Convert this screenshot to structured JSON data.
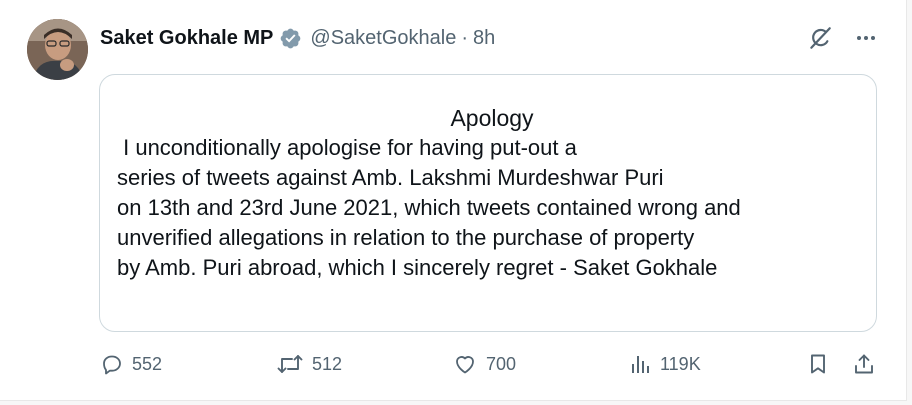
{
  "author": {
    "name": "Saket Gokhale MP",
    "handle": "@SaketGokhale",
    "separator": "·",
    "time": "8h"
  },
  "card": {
    "title": "Apology",
    "lines": [
      " I unconditionally apologise for having put-out a",
      "series of tweets against Amb. Lakshmi Murdeshwar Puri",
      "on 13th and 23rd June 2021, which tweets contained wrong and",
      "unverified allegations in relation to the purchase of property",
      "by Amb. Puri abroad, which I sincerely regret - Saket Gokhale"
    ]
  },
  "stats": {
    "replies": "552",
    "reposts": "512",
    "likes": "700",
    "views": "119K"
  },
  "icons": {
    "verified": "verified-badge-icon",
    "grok": "grok-icon",
    "more": "more-icon",
    "reply": "reply-icon",
    "repost": "repost-icon",
    "like": "heart-icon",
    "views": "views-icon",
    "bookmark": "bookmark-icon",
    "share": "share-icon"
  },
  "colors": {
    "text": "#0f1419",
    "secondary": "#536471",
    "badge": "#829aab",
    "border": "#cfd9de"
  }
}
